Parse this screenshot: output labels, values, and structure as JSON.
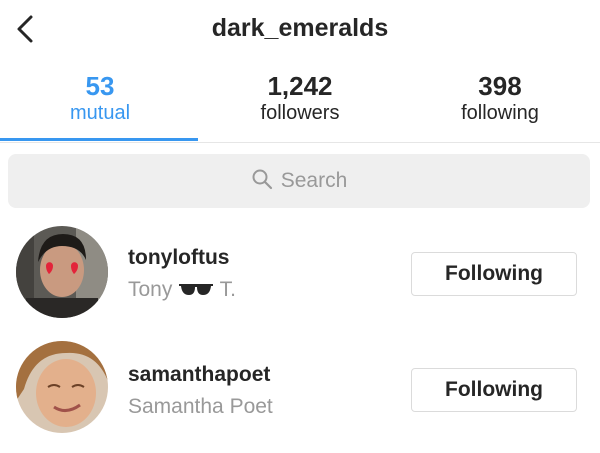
{
  "header": {
    "title": "dark_emeralds",
    "back_icon": "chevron-left-icon"
  },
  "tabs": [
    {
      "count": "53",
      "label": "mutual",
      "active": true
    },
    {
      "count": "1,242",
      "label": "followers",
      "active": false
    },
    {
      "count": "398",
      "label": "following",
      "active": false
    }
  ],
  "colors": {
    "accent": "#3897f0",
    "text": "#262626",
    "muted": "#999999",
    "search_bg": "#efefef",
    "border": "#dbdbdb"
  },
  "search": {
    "placeholder": "Search",
    "icon": "search-icon"
  },
  "users": [
    {
      "username": "tonyloftus",
      "fullname_before": "Tony",
      "fullname_icon": "sunglasses-icon",
      "fullname_after": "T.",
      "button_label": "Following"
    },
    {
      "username": "samanthapoet",
      "fullname": "Samantha Poet",
      "button_label": "Following"
    }
  ]
}
